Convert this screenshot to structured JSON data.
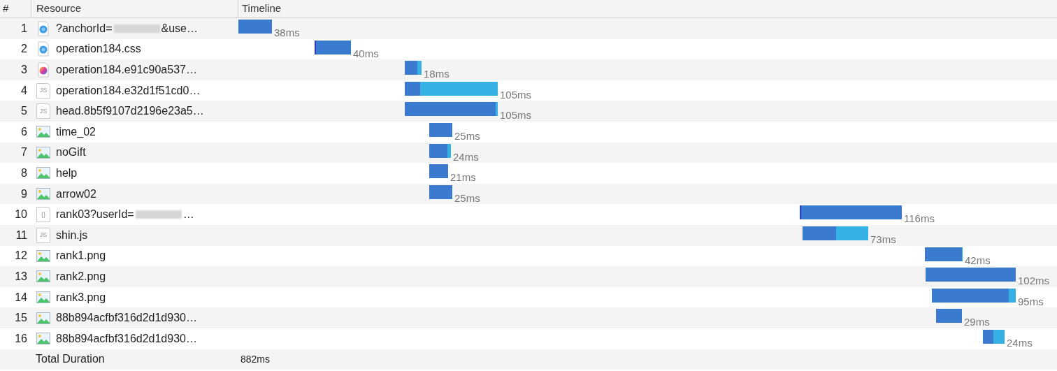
{
  "columns": [
    "#",
    "Resource",
    "Timeline"
  ],
  "rows": [
    {
      "index": "1",
      "kind": "document",
      "name": "?anchorId=",
      "redacted": true,
      "name_rest": "&use…",
      "duration": "38ms"
    },
    {
      "index": "2",
      "kind": "stylesheet",
      "name": "operation184.css",
      "duration": "40ms"
    },
    {
      "index": "3",
      "kind": "font",
      "name": "operation184.e91c90a537…",
      "duration": "18ms"
    },
    {
      "index": "4",
      "kind": "script",
      "icon_label": "JS",
      "name": "operation184.e32d1f51cd0…",
      "duration": "105ms"
    },
    {
      "index": "5",
      "kind": "script",
      "icon_label": "JS",
      "name": "head.8b5f9107d2196e23a5…",
      "duration": "105ms"
    },
    {
      "index": "6",
      "kind": "image",
      "name": "time_02",
      "duration": "25ms"
    },
    {
      "index": "7",
      "kind": "image",
      "name": "noGift",
      "duration": "24ms"
    },
    {
      "index": "8",
      "kind": "image",
      "name": "help",
      "duration": "21ms"
    },
    {
      "index": "9",
      "kind": "image",
      "name": "arrow02",
      "duration": "25ms"
    },
    {
      "index": "10",
      "kind": "json",
      "icon_label": "{}",
      "name": "rank03?userId=",
      "redacted": true,
      "name_rest": "…",
      "duration": "116ms"
    },
    {
      "index": "11",
      "kind": "script",
      "icon_label": "JS",
      "name": "shin.js",
      "duration": "73ms"
    },
    {
      "index": "12",
      "kind": "image",
      "name": "rank1.png",
      "duration": "42ms"
    },
    {
      "index": "13",
      "kind": "image",
      "name": "rank2.png",
      "duration": "102ms"
    },
    {
      "index": "14",
      "kind": "image",
      "name": "rank3.png",
      "duration": "95ms"
    },
    {
      "index": "15",
      "kind": "image",
      "name": "88b894acfbf316d2d1d930…",
      "duration": "29ms"
    },
    {
      "index": "16",
      "kind": "image",
      "name": "88b894acfbf316d2d1d930…",
      "duration": "24ms"
    }
  ],
  "total": {
    "label": "Total Duration",
    "value": "882ms"
  }
}
